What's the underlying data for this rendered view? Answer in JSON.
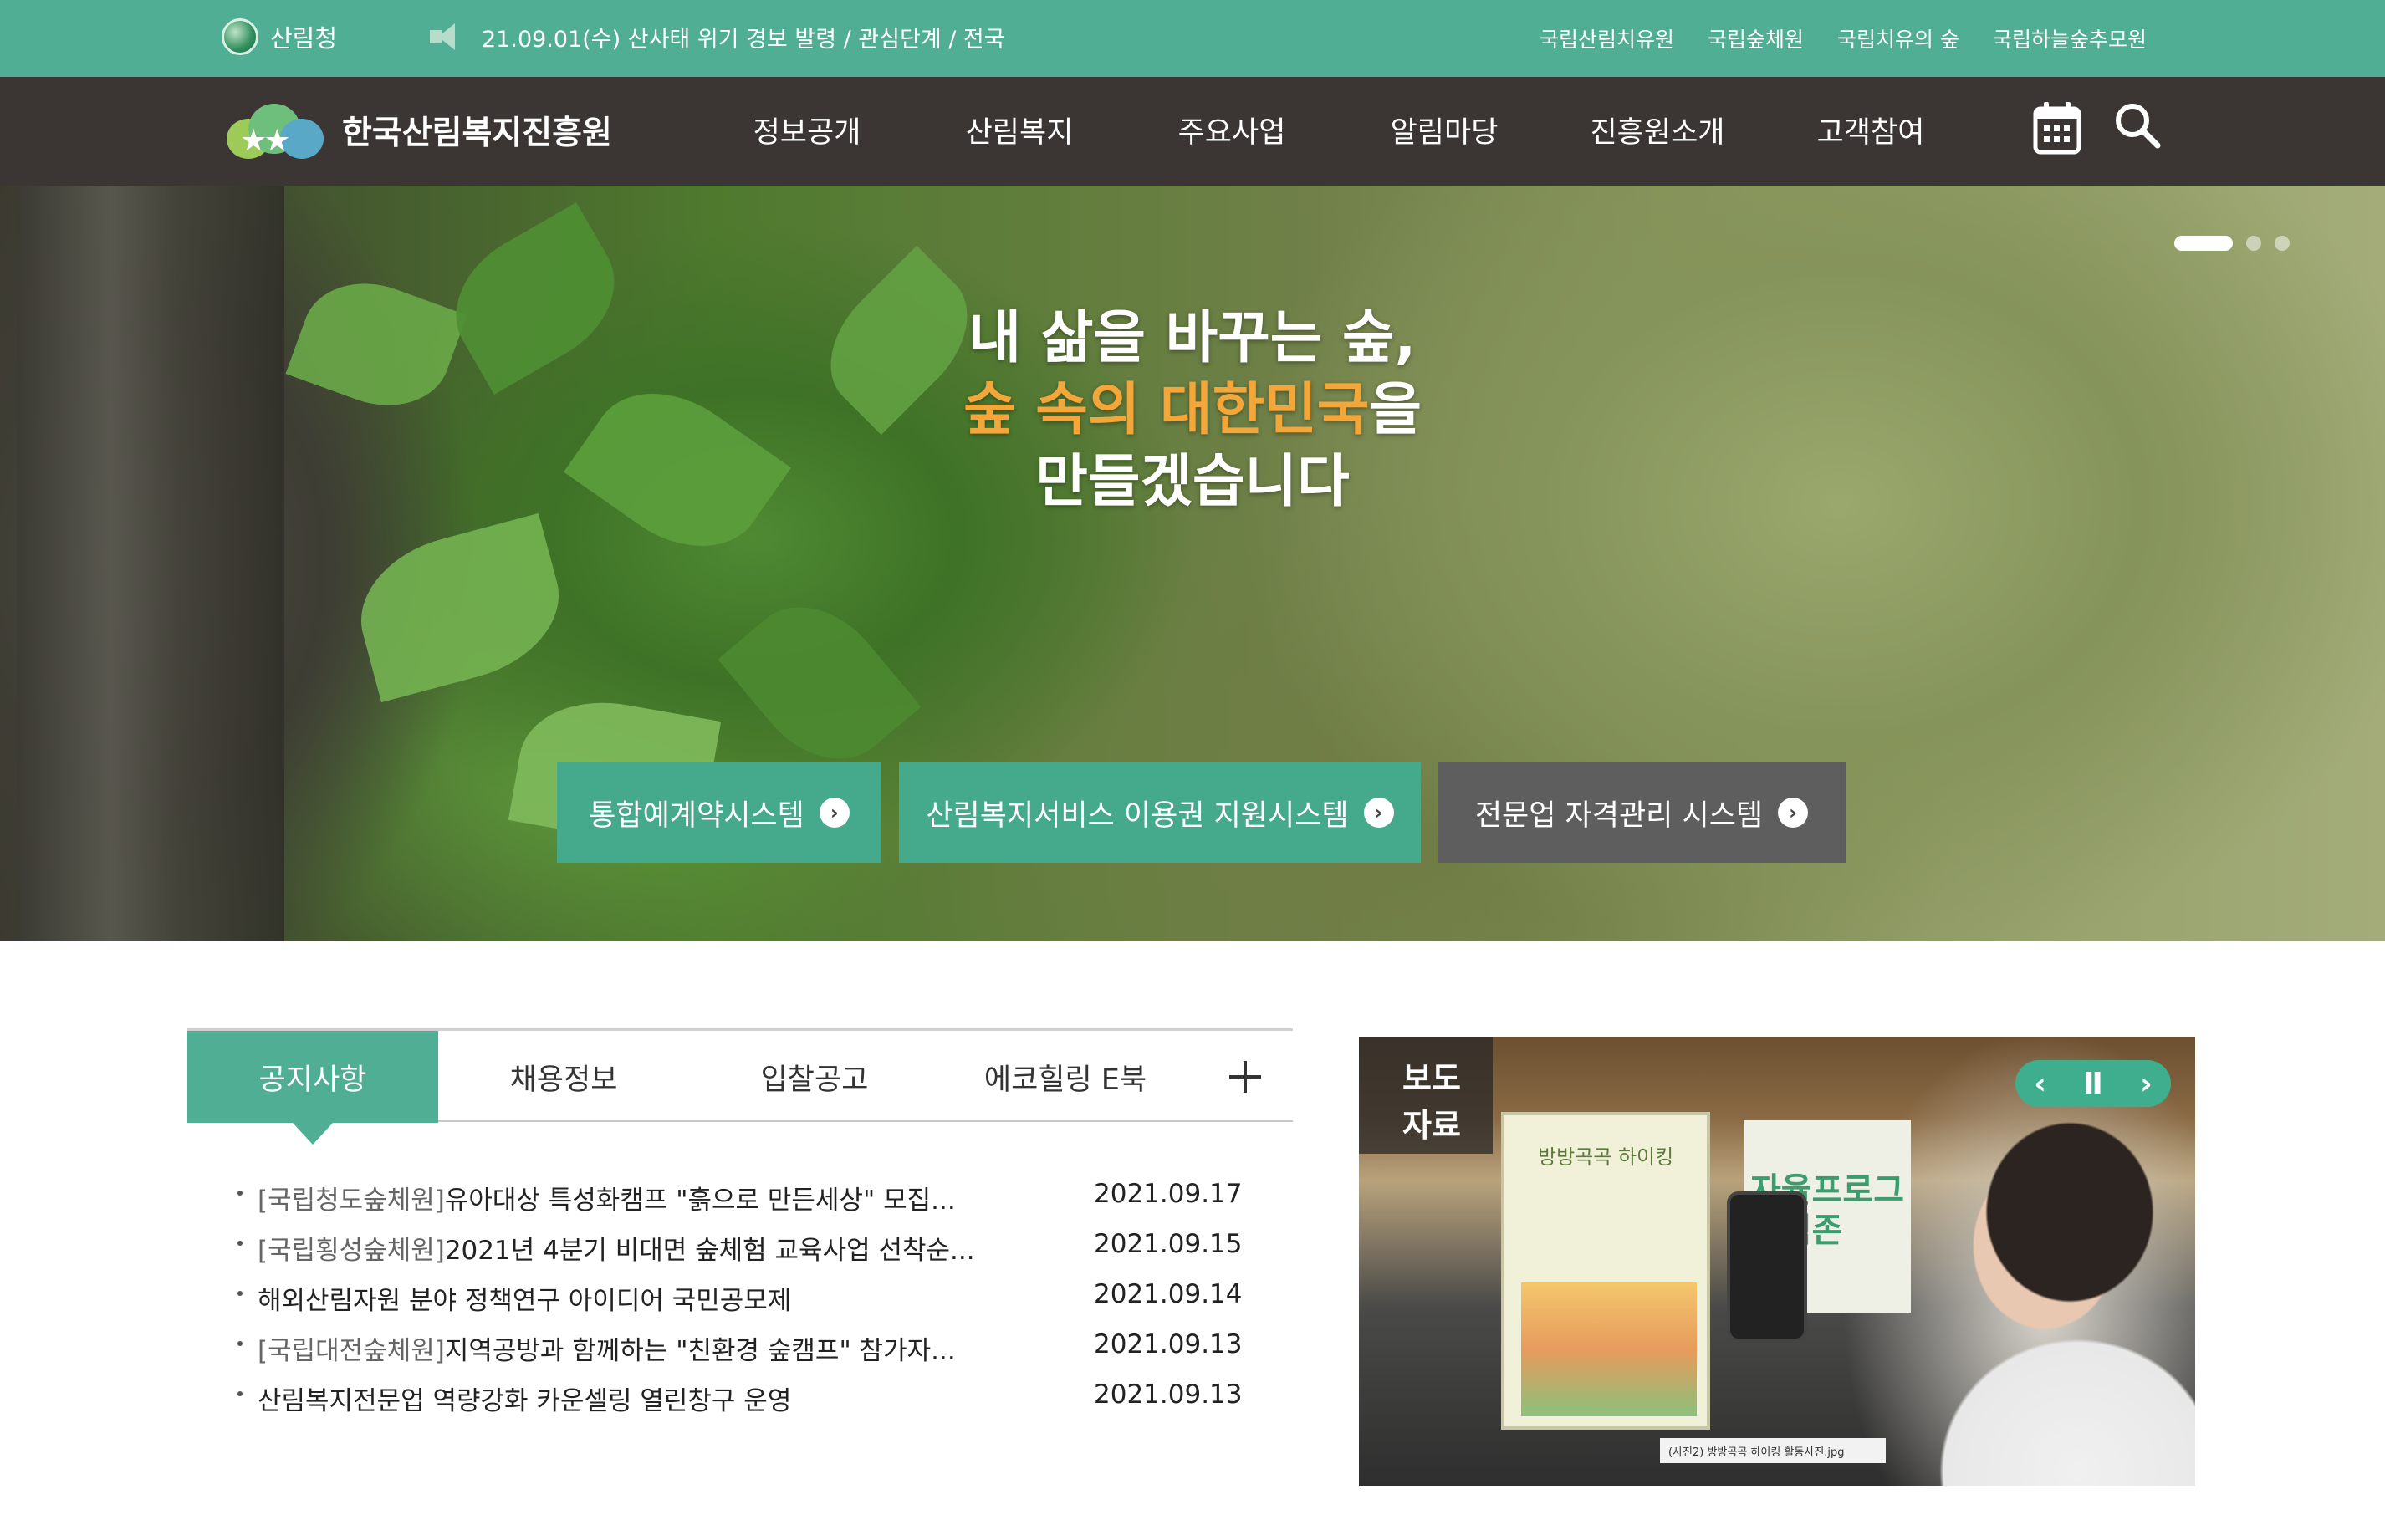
{
  "topbar": {
    "agency": "산림청",
    "alert": "21.09.01(수) 산사태 위기 경보 발령 / 관심단계 / 전국",
    "links": [
      "국립산림치유원",
      "국립숲체원",
      "국립치유의 숲",
      "국립하늘숲추모원"
    ]
  },
  "nav": {
    "site_name": "한국산림복지진흥원",
    "menu": [
      "정보공개",
      "산림복지",
      "주요사업",
      "알림마당",
      "진흥원소개",
      "고객참여"
    ],
    "tools": [
      "calendar-icon",
      "search-icon"
    ]
  },
  "hero": {
    "line1": "내 삶을 바꾸는 숲,",
    "line2_accent": "숲 속의 대한민국",
    "line2_rest": "을",
    "line3": "만들겠습니다",
    "slide_count": 3,
    "active_slide": 1,
    "buttons": [
      {
        "label": "통합예계약시스템",
        "style": "green"
      },
      {
        "label": "산림복지서비스 이용권 지원시스템",
        "style": "green"
      },
      {
        "label": "전문업 자격관리 시스템",
        "style": "gray"
      }
    ]
  },
  "notice": {
    "tabs": [
      "공지사항",
      "채용정보",
      "입찰공고",
      "에코힐링 E북"
    ],
    "active_tab": "공지사항",
    "items": [
      {
        "tag": "[국립청도숲체원]",
        "title": "유아대상 특성화캠프 \"흙으로 만든세상\" 모집...",
        "date": "2021.09.17"
      },
      {
        "tag": "[국립횡성숲체원]",
        "title": "2021년 4분기 비대면 숲체험 교육사업 선착순...",
        "date": "2021.09.15"
      },
      {
        "tag": "",
        "title": "해외산림자원 분야 정책연구 아이디어 국민공모제",
        "date": "2021.09.14"
      },
      {
        "tag": "[국립대전숲체원]",
        "title": "지역공방과 함께하는 \"친환경 숲캠프\" 참가자...",
        "date": "2021.09.13"
      },
      {
        "tag": "",
        "title": "산림복지전문업 역량강화 카운셀링 열린창구 운영",
        "date": "2021.09.13"
      }
    ]
  },
  "press": {
    "label_line1": "보도",
    "label_line2": "자료",
    "poster_title": "방방곡곡 하이킹",
    "sign_line1": "자율프로그",
    "sign_line2": "체험존",
    "photo_caption": "(사진2) 방방곡곡 하이킹 활동사진.jpg",
    "controls": {
      "prev": "‹",
      "pause": "Ⅱ",
      "next": "›"
    }
  },
  "colors": {
    "brand_green": "#4fae93",
    "nav_dark": "#3b3634",
    "accent_orange": "#f3a63a",
    "cta_gray": "#5e5e5e"
  }
}
